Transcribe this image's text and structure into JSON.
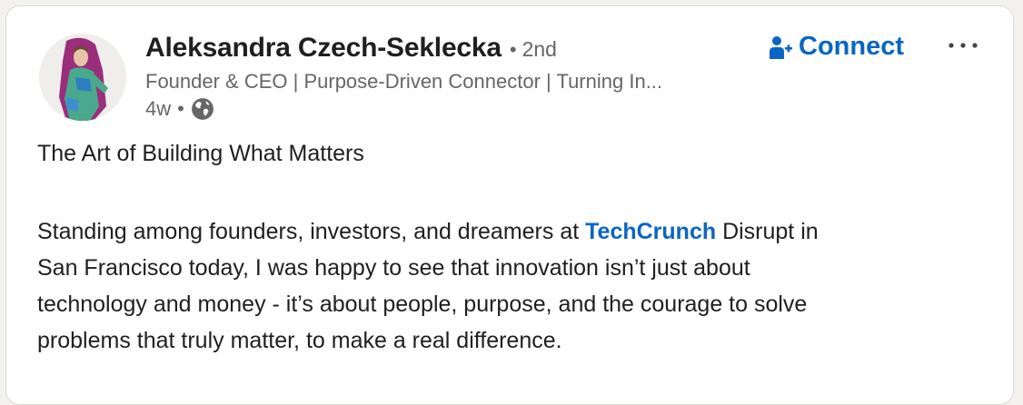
{
  "author": {
    "name": "Aleksandra Czech-Seklecka",
    "separator": "•",
    "degree": "2nd",
    "headline": "Founder & CEO | Purpose-Driven Connector | Turning In...",
    "time": "4w",
    "meta_separator": "•",
    "visibility_icon": "globe-icon",
    "avatar_colors": {
      "hood": "#9a2e7a",
      "body": "#4aa98c",
      "accent": "#2f7fc0"
    }
  },
  "actions": {
    "connect_label": "Connect",
    "connect_icon": "person-add-icon",
    "more_icon": "more-horizontal-icon"
  },
  "post": {
    "title": "The Art of Building What Matters",
    "body": {
      "line1_before": "Standing among founders, investors, and dreamers at ",
      "link": "TechCrunch",
      "line1_after": " Disrupt in",
      "line2": "San Francisco today, I was happy to see that innovation isn’t just about",
      "line3": "technology and money - it’s about people, purpose, and the courage to solve",
      "line4": "problems that truly matter, to make a real difference."
    }
  },
  "colors": {
    "link": "#0a66c2",
    "text": "#1f1f1f",
    "muted": "#666666"
  }
}
